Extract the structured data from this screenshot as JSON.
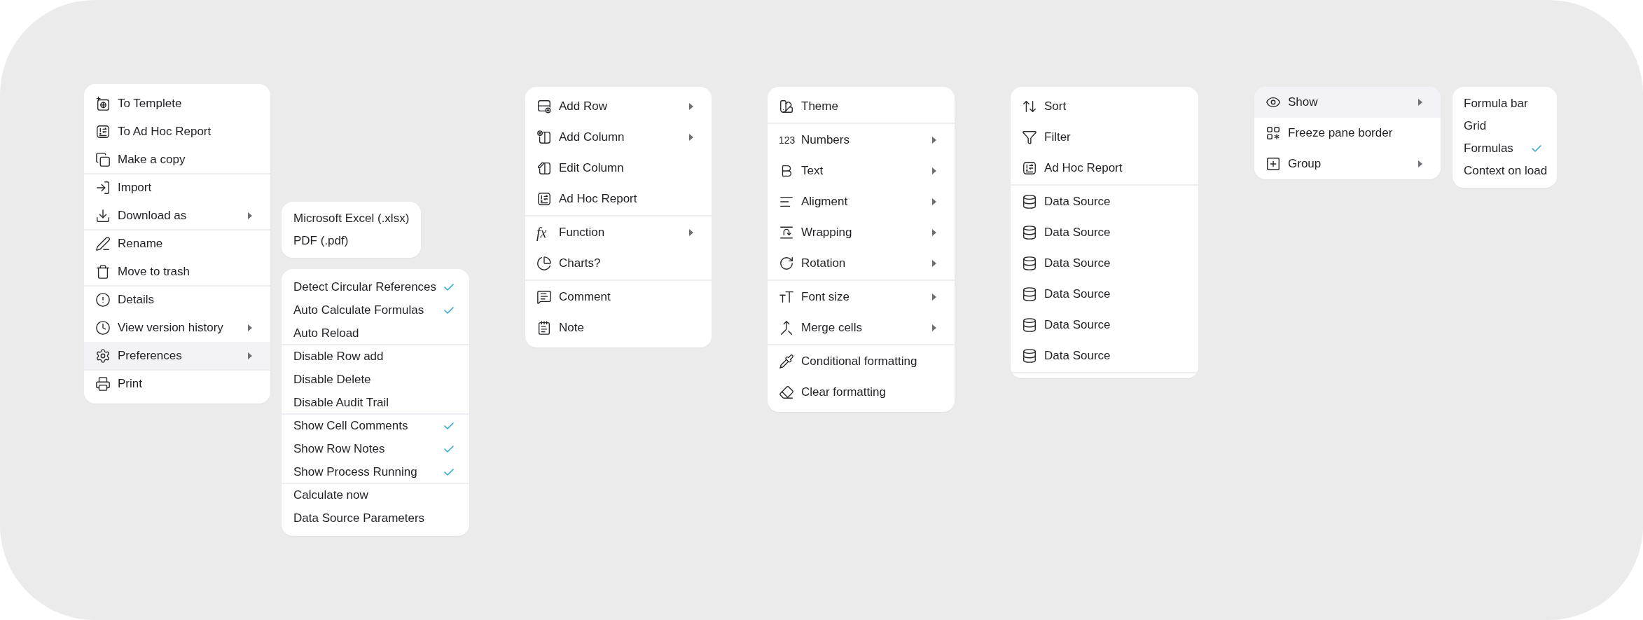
{
  "menus": [
    {
      "groups": [
        {
          "items": [
            {
              "label": "To Templete",
              "submenu": false,
              "selected": false
            },
            {
              "label": "To Ad Hoc Report",
              "submenu": false,
              "selected": false
            },
            {
              "label": "Make a copy",
              "submenu": false,
              "selected": false
            }
          ]
        },
        {
          "items": [
            {
              "label": "Import",
              "submenu": false,
              "selected": false
            },
            {
              "label": "Download as",
              "submenu": true,
              "selected": false
            }
          ]
        },
        {
          "items": [
            {
              "label": "Rename",
              "submenu": false,
              "selected": false
            },
            {
              "label": "Move to trash",
              "submenu": false,
              "selected": false
            }
          ]
        },
        {
          "items": [
            {
              "label": "Details",
              "submenu": false,
              "selected": false
            },
            {
              "label": "View version history",
              "submenu": true,
              "selected": false
            },
            {
              "label": "Preferences",
              "submenu": true,
              "selected": true
            }
          ]
        },
        {
          "items": [
            {
              "label": "Print",
              "submenu": false,
              "selected": false
            }
          ]
        }
      ]
    },
    {
      "groups": [
        {
          "items": [
            {
              "label": "Microsoft Excel (.xlsx)",
              "selected": false
            },
            {
              "label": "PDF (.pdf)",
              "selected": false
            }
          ]
        }
      ]
    },
    {
      "groups": [
        {
          "items": [
            {
              "label": "Detect Circular References",
              "checked": true,
              "selected": false
            },
            {
              "label": "Auto Calculate Formulas",
              "checked": true,
              "selected": false
            },
            {
              "label": "Auto Reload",
              "checked": false,
              "selected": false
            }
          ]
        },
        {
          "items": [
            {
              "label": "Disable Row add",
              "checked": false,
              "selected": false
            },
            {
              "label": "Disable Delete",
              "checked": false,
              "selected": false
            },
            {
              "label": "Disable Audit Trail",
              "checked": false,
              "selected": false
            }
          ]
        },
        {
          "items": [
            {
              "label": "Show Cell Comments",
              "checked": true,
              "selected": false
            },
            {
              "label": "Show Row Notes",
              "checked": true,
              "selected": false
            },
            {
              "label": "Show Process Running",
              "checked": true,
              "selected": false
            }
          ]
        },
        {
          "items": [
            {
              "label": "Calculate now",
              "checked": false,
              "selected": false
            },
            {
              "label": "Data Source Parameters",
              "checked": false,
              "selected": false
            }
          ]
        }
      ]
    },
    {
      "groups": [
        {
          "items": [
            {
              "label": "Add Row",
              "submenu": true,
              "selected": false
            },
            {
              "label": "Add Column",
              "submenu": true,
              "selected": false
            },
            {
              "label": "Edit Column",
              "submenu": false,
              "selected": false
            },
            {
              "label": "Ad Hoc Report",
              "submenu": false,
              "selected": false
            }
          ]
        },
        {
          "items": [
            {
              "glyph": "fx",
              "label": "Function",
              "submenu": true,
              "selected": false
            },
            {
              "label": "Charts?",
              "submenu": false,
              "selected": false
            }
          ]
        },
        {
          "items": [
            {
              "label": "Comment",
              "submenu": false,
              "selected": false
            },
            {
              "label": "Note",
              "submenu": false,
              "selected": false
            }
          ]
        }
      ]
    },
    {
      "groups": [
        {
          "items": [
            {
              "label": "Theme",
              "submenu": false,
              "selected": false
            }
          ]
        },
        {
          "items": [
            {
              "glyph": "123",
              "label": "Numbers",
              "submenu": true,
              "selected": false
            },
            {
              "label": "Text",
              "submenu": true,
              "selected": false
            },
            {
              "label": "Aligment",
              "submenu": true,
              "selected": false
            },
            {
              "label": "Wrapping",
              "submenu": true,
              "selected": false
            },
            {
              "label": "Rotation",
              "submenu": true,
              "selected": false
            }
          ]
        },
        {
          "items": [
            {
              "label": "Font size",
              "submenu": true,
              "selected": false
            },
            {
              "label": "Merge cells",
              "submenu": true,
              "selected": false
            }
          ]
        },
        {
          "items": [
            {
              "label": "Conditional formatting",
              "submenu": false,
              "selected": false
            },
            {
              "label": "Clear formatting",
              "submenu": false,
              "selected": false
            }
          ]
        }
      ]
    },
    {
      "groups": [
        {
          "items": [
            {
              "label": "Sort",
              "submenu": false,
              "selected": false
            },
            {
              "label": "Filter",
              "submenu": false,
              "selected": false
            },
            {
              "label": "Ad Hoc Report",
              "submenu": false,
              "selected": false
            }
          ]
        },
        {
          "items": [
            {
              "label": "Data Source",
              "submenu": false,
              "selected": false
            },
            {
              "label": "Data Source",
              "submenu": false,
              "selected": false
            },
            {
              "label": "Data Source",
              "submenu": false,
              "selected": false
            },
            {
              "label": "Data Source",
              "submenu": false,
              "selected": false
            },
            {
              "label": "Data Source",
              "submenu": false,
              "selected": false
            },
            {
              "label": "Data Source",
              "submenu": false,
              "selected": false
            }
          ]
        }
      ],
      "footer_divider": true
    },
    {
      "groups": [
        {
          "items": [
            {
              "label": "Show",
              "submenu": true,
              "selected": true
            },
            {
              "label": "Freeze pane border",
              "submenu": false,
              "selected": false
            },
            {
              "label": "Group",
              "submenu": true,
              "selected": false
            }
          ]
        }
      ]
    },
    {
      "groups": [
        {
          "items": [
            {
              "label": "Formula bar",
              "checked": false,
              "selected": false
            },
            {
              "label": "Grid",
              "checked": false,
              "selected": false
            },
            {
              "label": "Formulas",
              "checked": true,
              "selected": false
            },
            {
              "label": "Context on load",
              "checked": false,
              "selected": false
            }
          ]
        }
      ]
    }
  ]
}
